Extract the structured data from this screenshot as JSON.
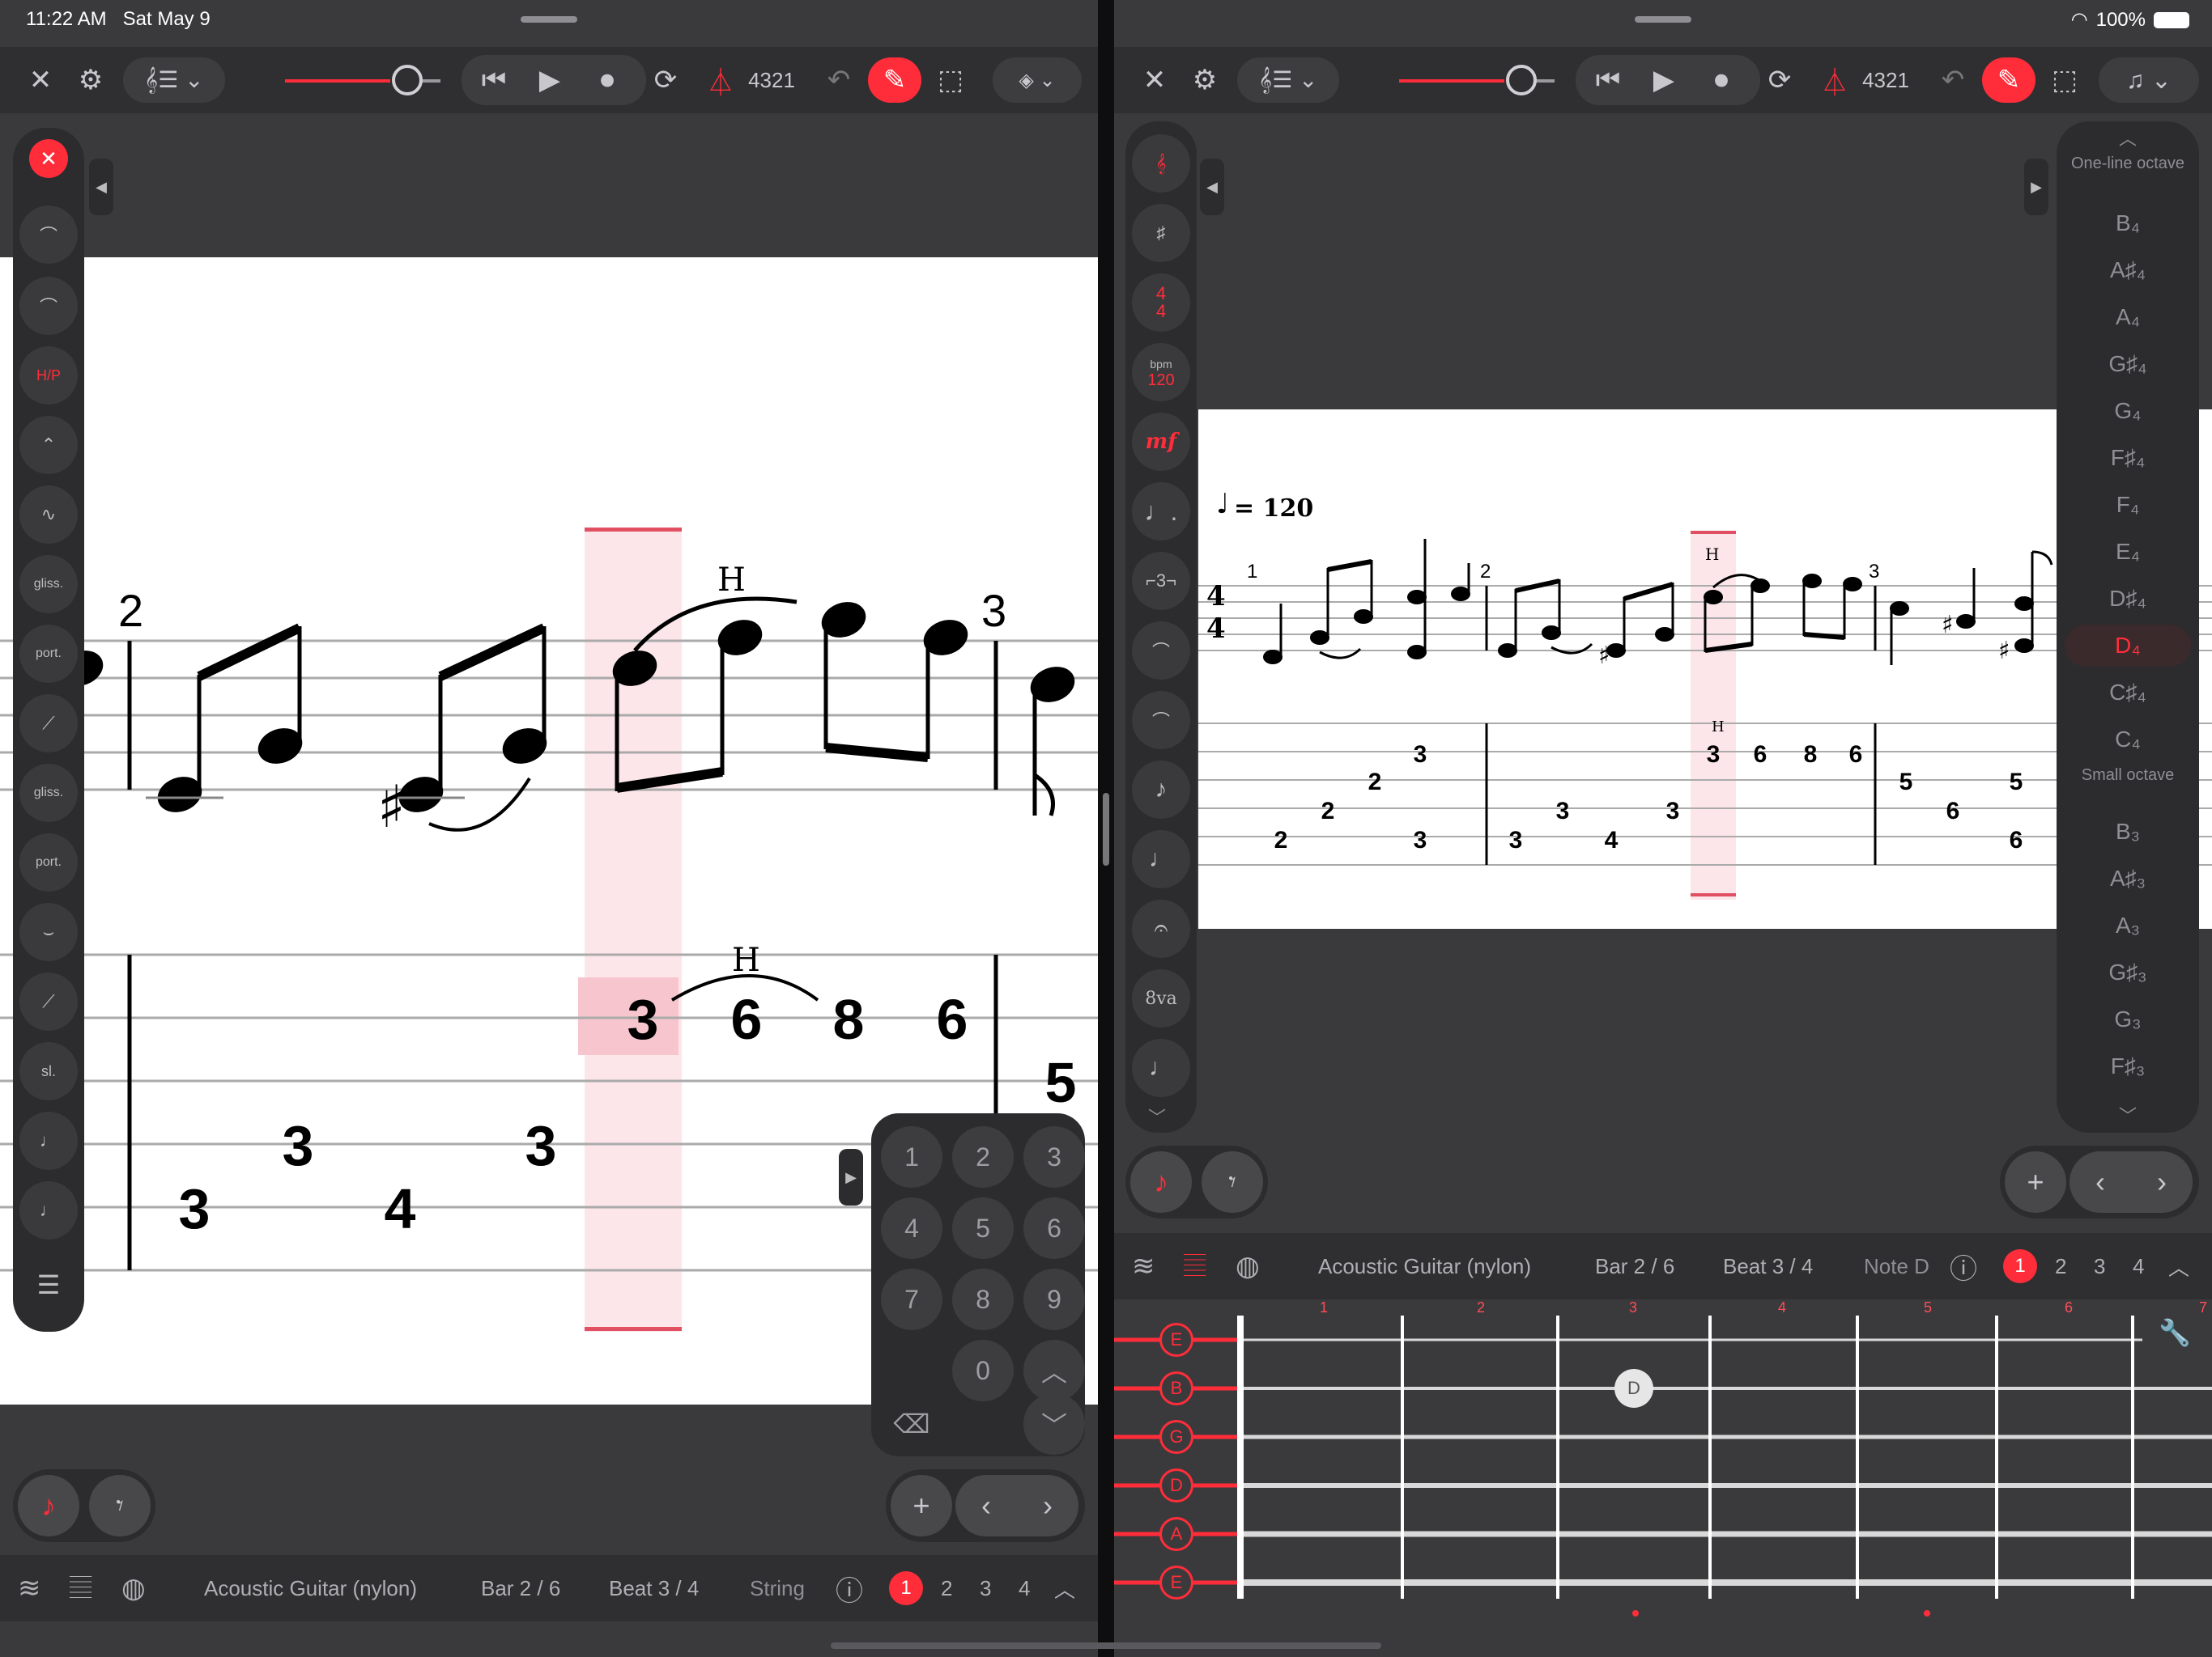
{
  "status": {
    "time": "11:22 AM",
    "date": "Sat May 9",
    "battery": "100%"
  },
  "toolbar": {
    "counter": "4321"
  },
  "left_sidebar": {
    "tools": [
      "x-slur",
      "slur",
      "H/P",
      "bend",
      "vibrato",
      "gliss.",
      "port.",
      "slide-out",
      "gliss.",
      "port.",
      "tie-slide",
      "slide-in",
      "sl.",
      "grace-down",
      "grace-up",
      "list"
    ]
  },
  "score_left": {
    "bar2_label": "2",
    "bar3_label": "3",
    "hammer_label": "H",
    "tab_numbers_top": [
      "3",
      "6",
      "8",
      "6"
    ],
    "tab_numbers_mid": [
      "3",
      "3"
    ],
    "tab_numbers_low": [
      "3",
      "4"
    ],
    "tab_next_bar": "5"
  },
  "numpad": {
    "keys": [
      "1",
      "2",
      "3",
      "4",
      "5",
      "6",
      "7",
      "8",
      "9",
      "0"
    ]
  },
  "bottom_left": {
    "instrument": "Acoustic Guitar (nylon)",
    "bar": "Bar 2 / 6",
    "beat": "Beat 3 / 4",
    "field": "String",
    "voices": [
      "1",
      "2",
      "3",
      "4"
    ]
  },
  "right_sidebar": {
    "time_sig_top": "4",
    "time_sig_bottom": "4",
    "bpm_label": "bpm",
    "bpm_value": "120",
    "dynamic": "mf",
    "triplet": "3",
    "ottava": "8va"
  },
  "score_right": {
    "tempo": "= 120",
    "time_sig": [
      "4",
      "4"
    ],
    "bar_nums": [
      "1",
      "2",
      "3"
    ],
    "hammer": "H",
    "tab": {
      "bar1": [
        "2",
        "2",
        "2",
        "3",
        "3"
      ],
      "bar2": [
        "3",
        "3",
        "4",
        "3"
      ],
      "bar2b": [
        "3",
        "6",
        "8",
        "6"
      ],
      "bar3": [
        "5",
        "6",
        "6",
        "5"
      ]
    }
  },
  "note_picker": {
    "label_top": "One-line octave",
    "label_small": "Small octave",
    "notes_upper": [
      "B₄",
      "A♯₄",
      "A₄",
      "G♯₄",
      "G₄",
      "F♯₄",
      "F₄",
      "E₄",
      "D♯₄",
      "D₄",
      "C♯₄",
      "C₄"
    ],
    "notes_lower": [
      "B₃",
      "A♯₃",
      "A₃",
      "G♯₃",
      "G₃",
      "F♯₃"
    ],
    "selected": "D₄"
  },
  "bottom_right": {
    "instrument": "Acoustic Guitar (nylon)",
    "bar": "Bar 2 / 6",
    "beat": "Beat 3 / 4",
    "field": "Note D",
    "voices": [
      "1",
      "2",
      "3",
      "4"
    ]
  },
  "fretboard": {
    "strings": [
      "E",
      "B",
      "G",
      "D",
      "A",
      "E"
    ],
    "fret_numbers": [
      "1",
      "2",
      "3",
      "4",
      "5",
      "6",
      "7"
    ],
    "marker": "D"
  },
  "colors": {
    "accent": "#ff2d3a",
    "panel": "#2c2c2e",
    "background": "#3a3a3c"
  }
}
